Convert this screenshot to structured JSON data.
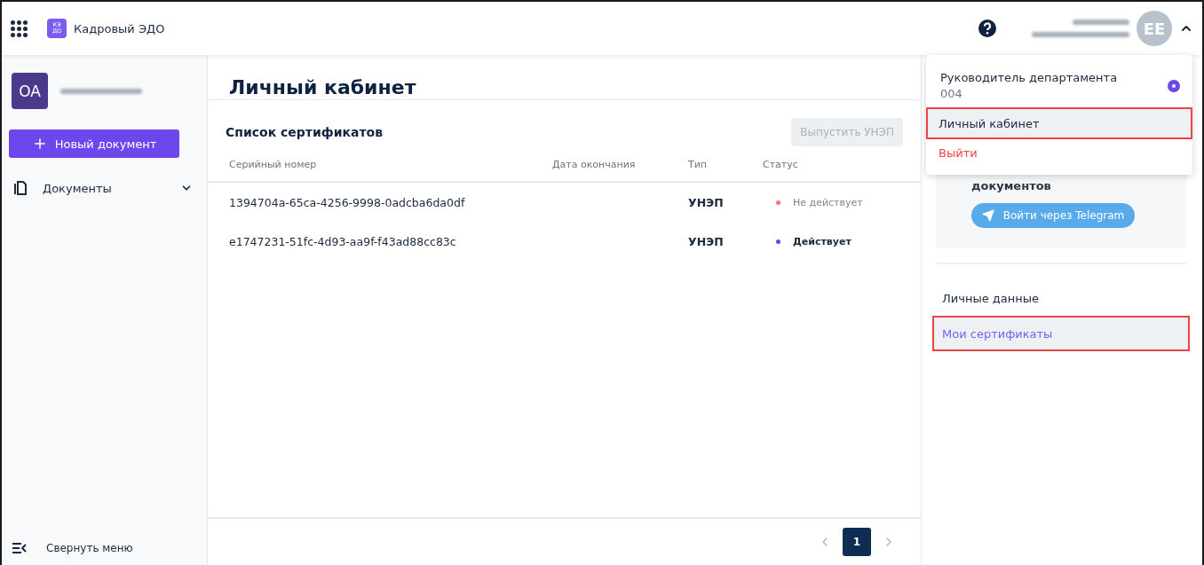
{
  "app": {
    "title": "Кадровый ЭДО",
    "logo": "КЭДО"
  },
  "header": {
    "avatar": "EE",
    "menu_expanded": true
  },
  "sidebar": {
    "org_avatar": "OA",
    "new_button": "Новый документ",
    "items": [
      {
        "label": "Документы",
        "expanded": false
      }
    ],
    "collapse": "Свернуть меню"
  },
  "page": {
    "title": "Личный кабинет"
  },
  "certificates": {
    "title": "Список сертификатов",
    "issue_button": {
      "label": "Выпустить УНЭП",
      "disabled": true
    },
    "columns": [
      "Серийный номер",
      "Дата окончания",
      "Тип",
      "Статус"
    ],
    "rows": [
      {
        "serial": "1394704a-65ca-4256-9998-0adcba6da0df",
        "type": "УНЭП",
        "status": "Не действует",
        "valid": false,
        "color": "#f27474"
      },
      {
        "serial": "e1747231-51fc-4d93-aa9f-f43ad88cc83c",
        "type": "УНЭП",
        "status": "Действует",
        "valid": true,
        "color": "#6a44e6"
      }
    ],
    "pages": [
      {
        "label": "1",
        "selected": true
      }
    ]
  },
  "right_panel": {
    "card_text": "документов",
    "telegram_button": "Войти через Telegram",
    "links": [
      {
        "label": "Личные данные",
        "selected": false,
        "highlighted": false
      },
      {
        "label": "Мои сертификаты",
        "selected": true,
        "highlighted": true
      }
    ]
  },
  "dropdown": {
    "role": "Руководитель департамента",
    "role_code": "004",
    "role_selected": true,
    "items": [
      {
        "label": "Личный кабинет",
        "kind": "normal",
        "highlighted": true
      },
      {
        "label": "Выйти",
        "kind": "danger",
        "highlighted": false
      }
    ]
  }
}
